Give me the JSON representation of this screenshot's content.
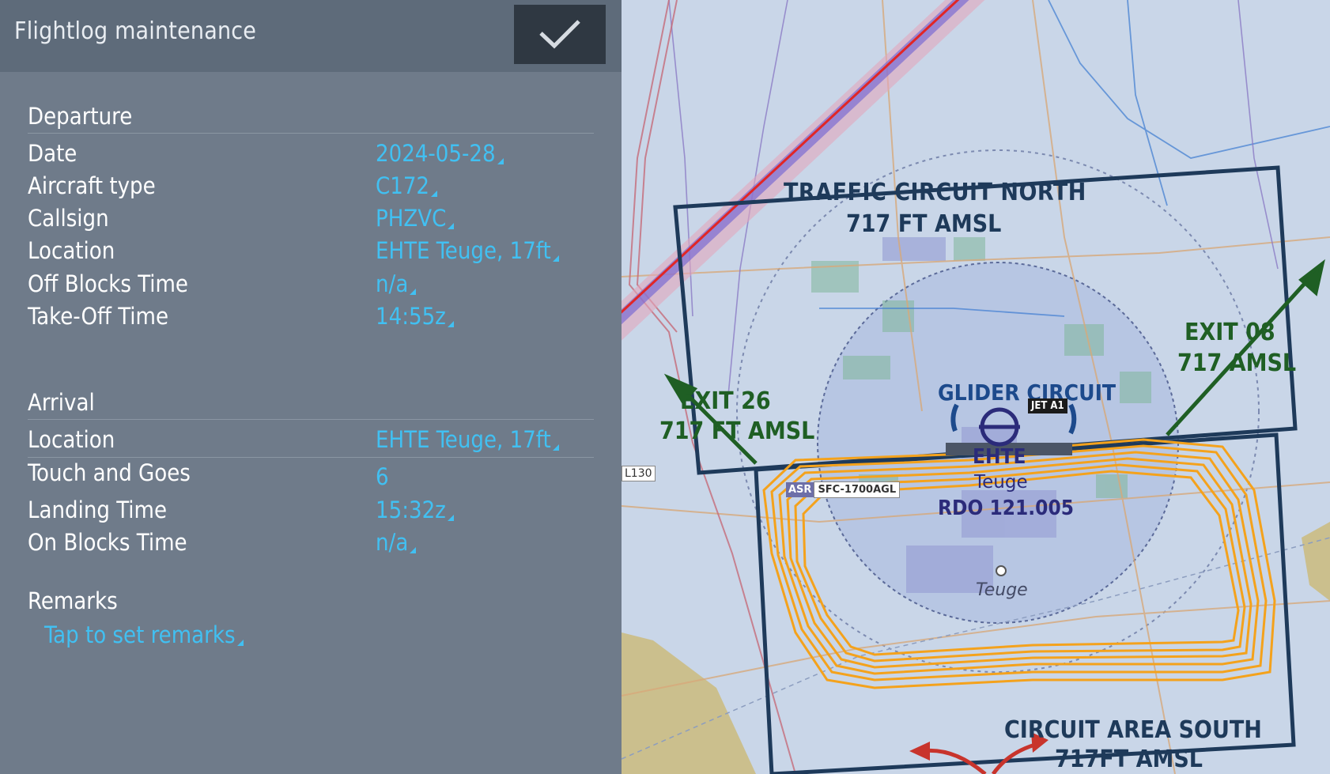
{
  "header": {
    "title": "Flightlog maintenance",
    "confirm_icon": "checkmark-icon"
  },
  "departure": {
    "section_title": "Departure",
    "rows": [
      {
        "label": "Date",
        "value": "2024-05-28"
      },
      {
        "label": "Aircraft type",
        "value": "C172"
      },
      {
        "label": "Callsign",
        "value": "PHZVC"
      },
      {
        "label": "Location",
        "value": "EHTE Teuge, 17ft"
      },
      {
        "label": "Off Blocks Time",
        "value": "n/a"
      },
      {
        "label": "Take-Off Time",
        "value": "14:55z"
      }
    ]
  },
  "arrival": {
    "section_title": "Arrival",
    "rows": [
      {
        "label": "Location",
        "value": "EHTE Teuge, 17ft"
      },
      {
        "label": "Touch and Goes",
        "value": "6"
      },
      {
        "label": "Landing Time",
        "value": "15:32z"
      },
      {
        "label": "On Blocks Time",
        "value": "n/a"
      }
    ]
  },
  "remarks": {
    "section_title": "Remarks",
    "placeholder": "Tap to set remarks"
  },
  "map": {
    "traffic_circuit_north": "TRAFFIC CIRCUIT NORTH",
    "traffic_circuit_north_alt": "717 FT AMSL",
    "exit_26": "EXIT 26",
    "exit_26_alt": "717 FT AMSL",
    "exit_08": "EXIT 08",
    "exit_08_alt": "717 AMSL",
    "glider_circuit": "GLIDER CIRCUIT",
    "jet_a1": "JET A1",
    "airport_code": "EHTE",
    "airport_name": "Teuge",
    "radio": "RDO 121.005",
    "asr_tag": "ASR",
    "asr_limits": "SFC-1700AGL",
    "airway": "L130",
    "town": "Teuge",
    "circuit_area_south": "CIRCUIT AREA SOUTH",
    "circuit_area_south_alt": "717FT AMSL",
    "colors": {
      "track": "#f4a21c",
      "airspace_box": "#1e3a5a",
      "exit_text": "#1f5f24",
      "accent_value": "#41c0f2"
    }
  }
}
